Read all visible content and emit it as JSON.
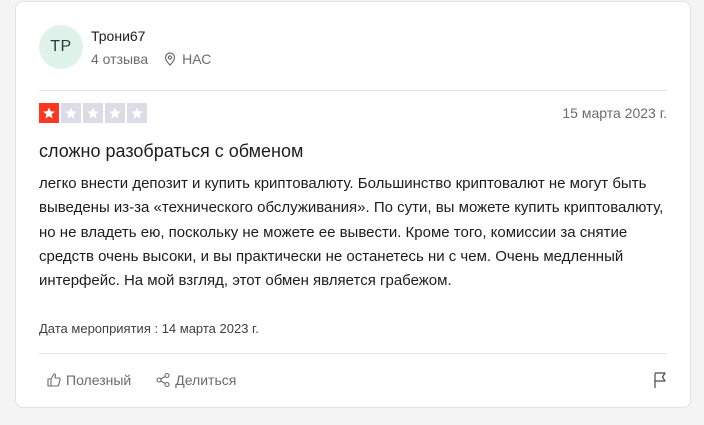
{
  "review": {
    "avatar_initials": "TP",
    "avatar_bg": "#dff3ea",
    "author": "Трони67",
    "reviews_count": "4 отзыва",
    "location_icon": "map-pin-icon",
    "location": "НАС",
    "rating": 1,
    "rating_max": 5,
    "star_filled_color": "#ff3722",
    "star_empty_color": "#dcdce6",
    "date": "15 марта 2023 г.",
    "title": "сложно разобраться с обменом",
    "body": "легко внести депозит и купить криптовалюту. Большинство криптовалют не могут быть выведены из-за «технического обслуживания». По сути, вы можете купить криптовалюту, но не владеть ею, поскольку не можете ее вывести. Кроме того, комиссии за снятие средств очень высоки, и вы практически не останетесь ни с чем. Очень медленный интерфейс. На мой взгляд, этот обмен является грабежом.",
    "event_date": "Дата мероприятия : 14 марта 2023 г."
  },
  "actions": {
    "useful_label": "Полезный",
    "useful_icon": "thumbs-up-icon",
    "share_label": "Делиться",
    "share_icon": "share-icon",
    "report_icon": "flag-icon"
  }
}
